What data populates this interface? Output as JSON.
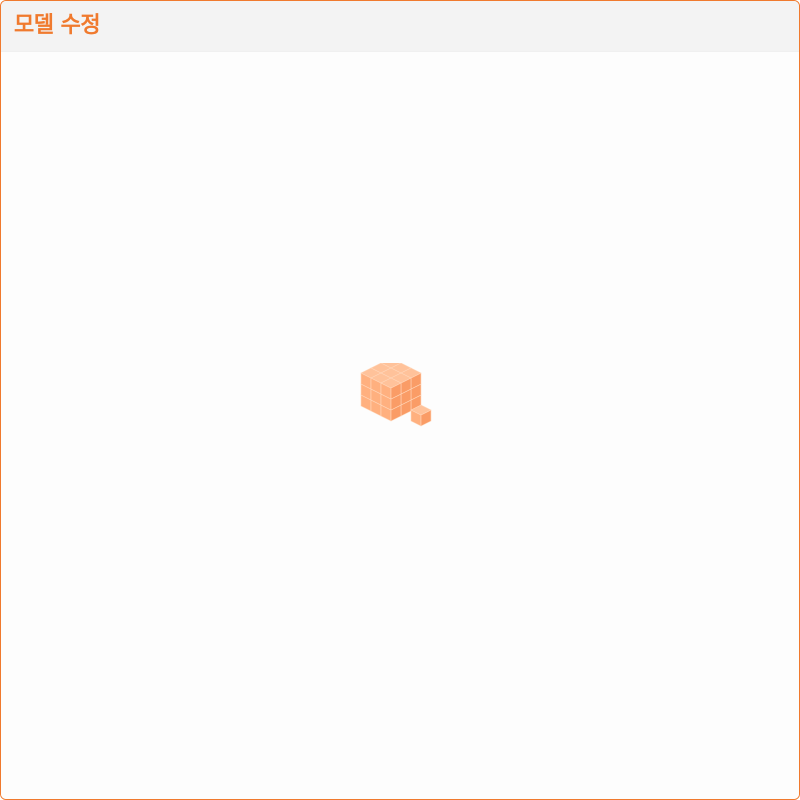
{
  "window": {
    "title": "모델 수정"
  },
  "canvas": {
    "icon": "stacked-cubes-icon"
  },
  "colors": {
    "accent": "#f07a2e",
    "title": "#f07a2e",
    "cube_top": "#ffc29a",
    "cube_left": "#ffb07f",
    "cube_right": "#fa9c66",
    "titlebar_bg": "#f3f3f3",
    "canvas_bg": "#fdfdfd"
  }
}
